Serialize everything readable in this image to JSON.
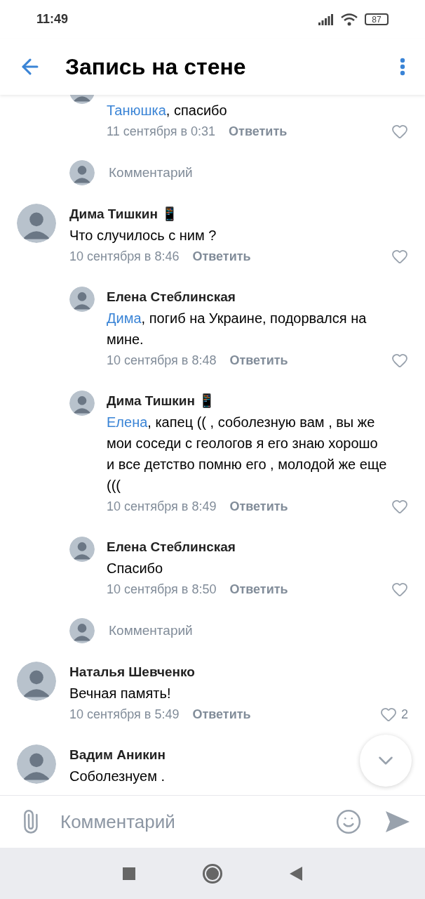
{
  "status_bar": {
    "time": "11:49",
    "battery": "87"
  },
  "header": {
    "title": "Запись на стене"
  },
  "feed": [
    {
      "kind": "reply",
      "mention": "Танюшка",
      "text": ", спасибо",
      "date": "11 сентября в 0:31",
      "action": "Ответить"
    },
    {
      "kind": "prompt",
      "placeholder": "Комментарий"
    },
    {
      "kind": "comment",
      "name": "Дима Тишкин 📱",
      "text": "Что случилось с ним ?",
      "date": "10 сентября в 8:46",
      "action": "Ответить"
    },
    {
      "kind": "reply",
      "name": "Елена Стеблинская",
      "mention": "Дима",
      "text": ", погиб на Украине, подорвался на   мине.",
      "date": "10 сентября в 8:48",
      "action": "Ответить"
    },
    {
      "kind": "reply",
      "name": "Дима Тишкин 📱",
      "mention": "Елена",
      "text": ", капец (( , соболезную вам , вы же мои соседи с геологов я его знаю хорошо и все детство помню его , молодой же еще (((",
      "date": "10 сентября в 8:49",
      "action": "Ответить"
    },
    {
      "kind": "reply",
      "name": "Елена Стеблинская",
      "text": "Спасибо",
      "date": "10 сентября в 8:50",
      "action": "Ответить"
    },
    {
      "kind": "prompt",
      "placeholder": "Комментарий"
    },
    {
      "kind": "comment",
      "name": "Наталья Шевченко",
      "text": "Вечная память!",
      "date": "10 сентября в 5:49",
      "action": "Ответить",
      "likes": "2"
    },
    {
      "kind": "comment",
      "name": "Вадим Аникин",
      "text": "Соболезнуем ."
    }
  ],
  "composer": {
    "placeholder": "Комментарий"
  }
}
